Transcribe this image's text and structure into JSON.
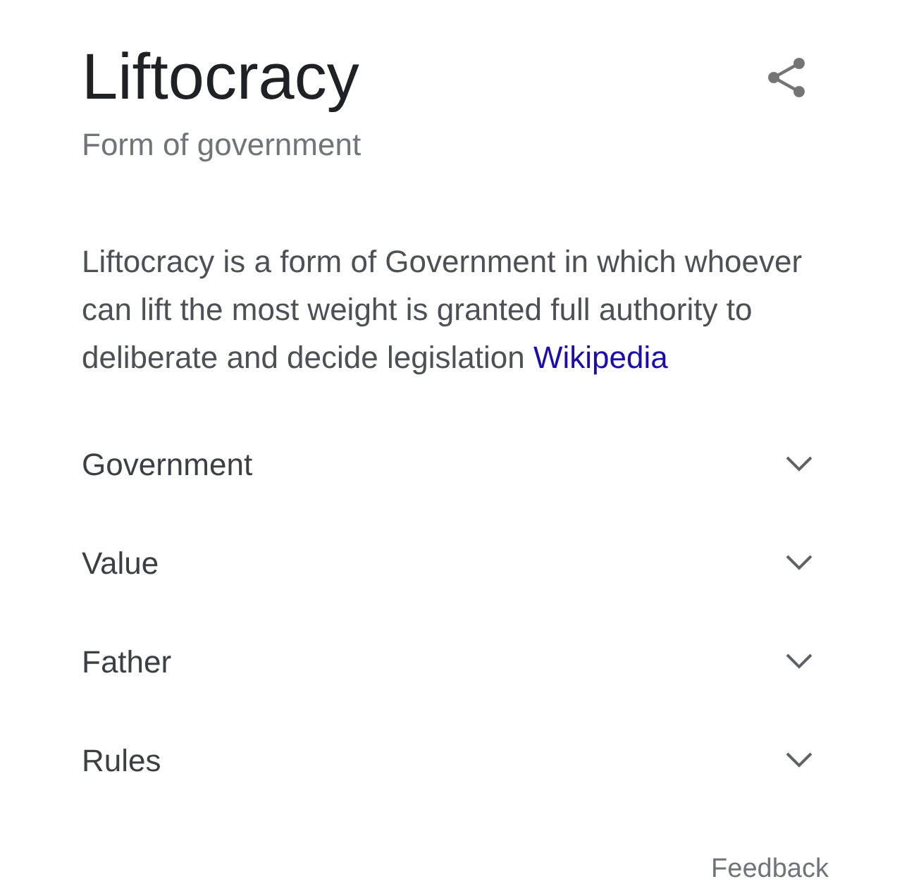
{
  "entity": {
    "title": "Liftocracy",
    "subtitle": "Form of government"
  },
  "description": {
    "text": "Liftocracy is a form of Government in which whoever can lift the most weight is granted full authority to deliberate and decide legislation",
    "source_link": "Wikipedia"
  },
  "sections": [
    {
      "label": "Government",
      "expanded": false
    },
    {
      "label": "Value",
      "expanded": false
    },
    {
      "label": "Father",
      "expanded": false
    },
    {
      "label": "Rules",
      "expanded": false
    }
  ],
  "feedback": "Feedback"
}
